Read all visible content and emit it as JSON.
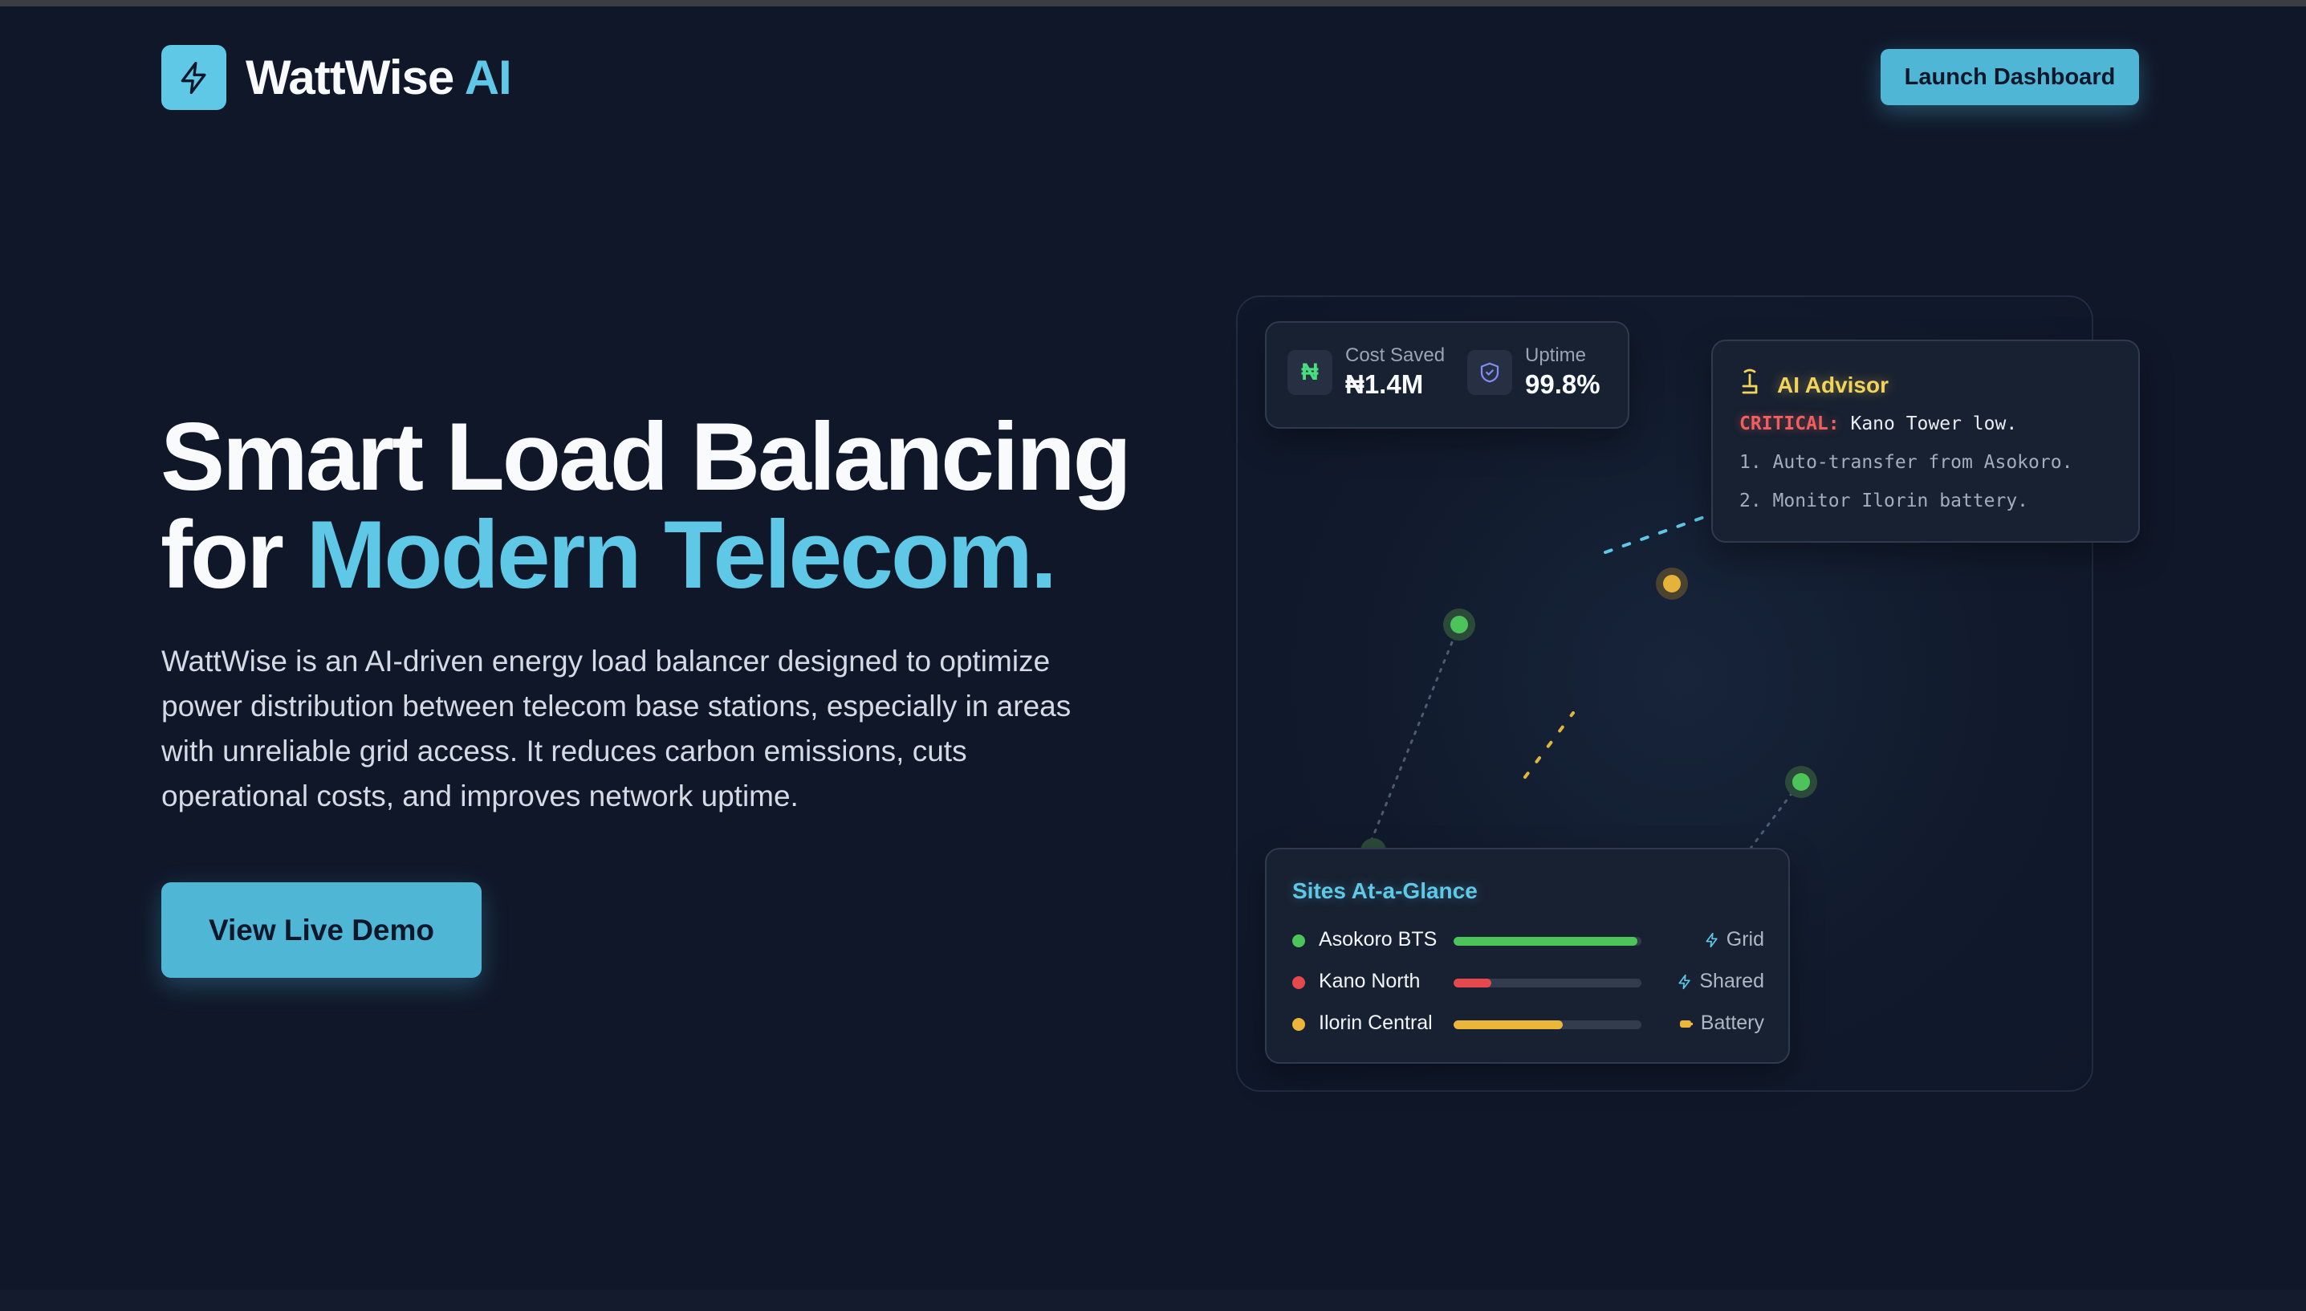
{
  "brand": {
    "name": "WattWise",
    "suffix": "AI"
  },
  "header": {
    "launch_label": "Launch Dashboard"
  },
  "hero": {
    "headline_line1": "Smart Load Balancing",
    "headline_for": "for",
    "headline_accent": "Modern Telecom.",
    "description": "WattWise is an AI-driven energy load balancer designed to optimize power distribution between telecom base stations, especially in areas with unreliable grid access. It reduces carbon emissions, cuts operational costs, and improves network uptime.",
    "cta_label": "View Live Demo"
  },
  "stats": [
    {
      "label": "Cost Saved",
      "value": "₦1.4M",
      "icon": "naira-icon",
      "icon_text": "₦",
      "color": "#4ade80"
    },
    {
      "label": "Uptime",
      "value": "99.8%",
      "icon": "shield-check-icon",
      "color": "#818cf8"
    }
  ],
  "advisor": {
    "title": "AI Advisor",
    "icon": "robot-icon",
    "critical_label": "CRITICAL:",
    "critical_text": " Kano Tower low.",
    "steps": [
      "1. Auto-transfer from Asokoro.",
      "2. Monitor Ilorin battery."
    ]
  },
  "sites": {
    "title": "Sites At-a-Glance",
    "items": [
      {
        "name": "Asokoro BTS",
        "level": 0.98,
        "color": "#4cc45a",
        "source": "Grid",
        "source_icon": "bolt-icon"
      },
      {
        "name": "Kano North",
        "level": 0.2,
        "color": "#e5484d",
        "source": "Shared",
        "source_icon": "bolt-icon"
      },
      {
        "name": "Ilorin Central",
        "level": 0.58,
        "color": "#eab73b",
        "source": "Battery",
        "source_icon": "battery-icon"
      }
    ]
  },
  "colors": {
    "accent": "#5ec8e6",
    "background": "#101729",
    "good": "#4cc45a",
    "warn": "#eab73b",
    "critical": "#e5484d"
  }
}
